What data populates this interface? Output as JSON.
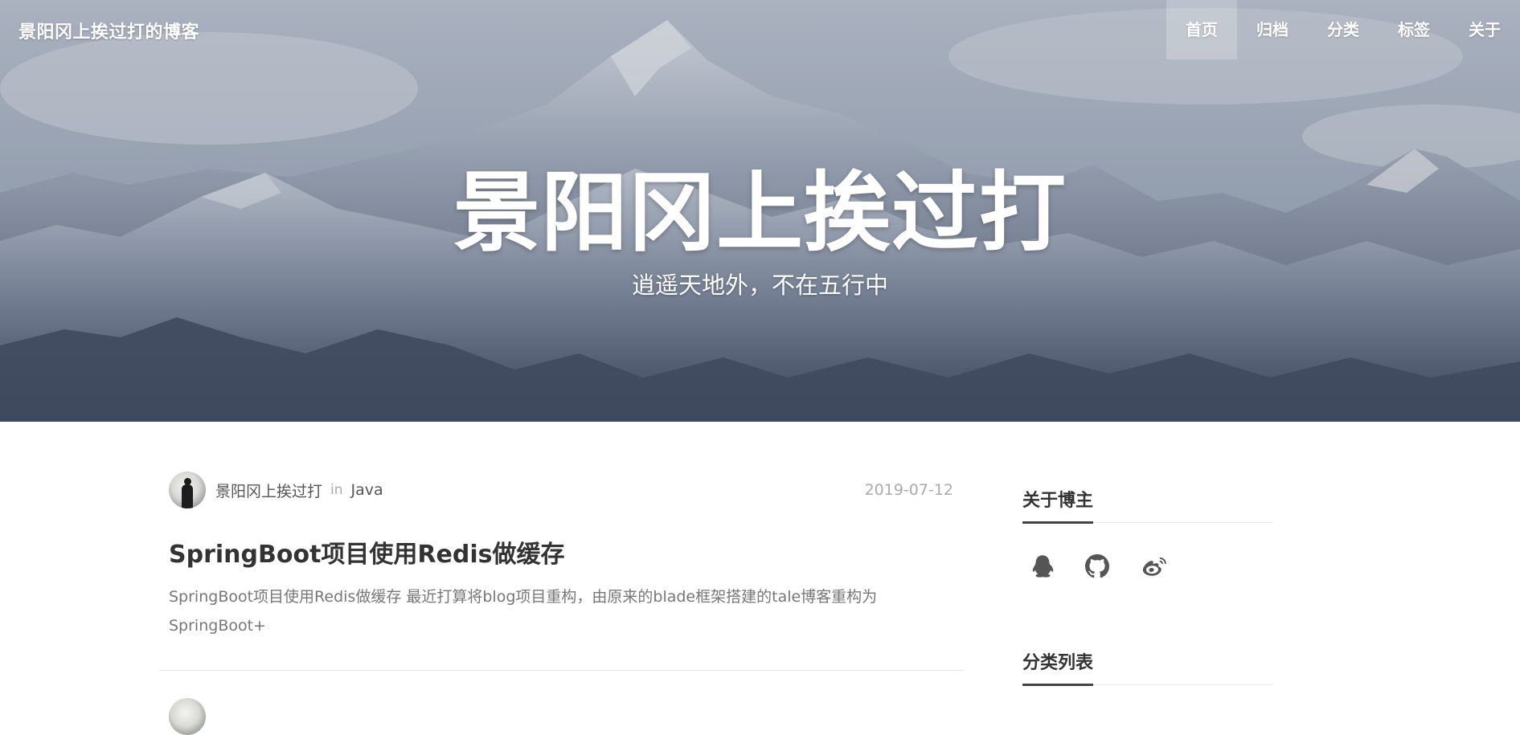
{
  "header": {
    "site_title": "景阳冈上挨过打的博客",
    "nav": [
      {
        "label": "首页",
        "active": true
      },
      {
        "label": "归档",
        "active": false
      },
      {
        "label": "分类",
        "active": false
      },
      {
        "label": "标签",
        "active": false
      },
      {
        "label": "关于",
        "active": false
      }
    ]
  },
  "hero": {
    "heading": "景阳冈上挨过打",
    "subtitle": "逍遥天地外，不在五行中"
  },
  "posts": [
    {
      "author": "景阳冈上挨过打",
      "in_word": "in",
      "category": "Java",
      "date": "2019-07-12",
      "title": "SpringBoot项目使用Redis做缓存",
      "excerpt": "SpringBoot项目使用Redis做缓存 最近打算将blog项目重构，由原来的blade框架搭建的tale博客重构为SpringBoot+"
    }
  ],
  "sidebar": {
    "about_title": "关于博主",
    "social_icons": [
      "qq-icon",
      "github-icon",
      "weibo-icon"
    ],
    "category_title": "分类列表"
  },
  "colors": {
    "nav_active_bg": "rgba(255,255,255,0.22)",
    "text_dark": "#333333",
    "text_muted": "#aaaaaa"
  }
}
